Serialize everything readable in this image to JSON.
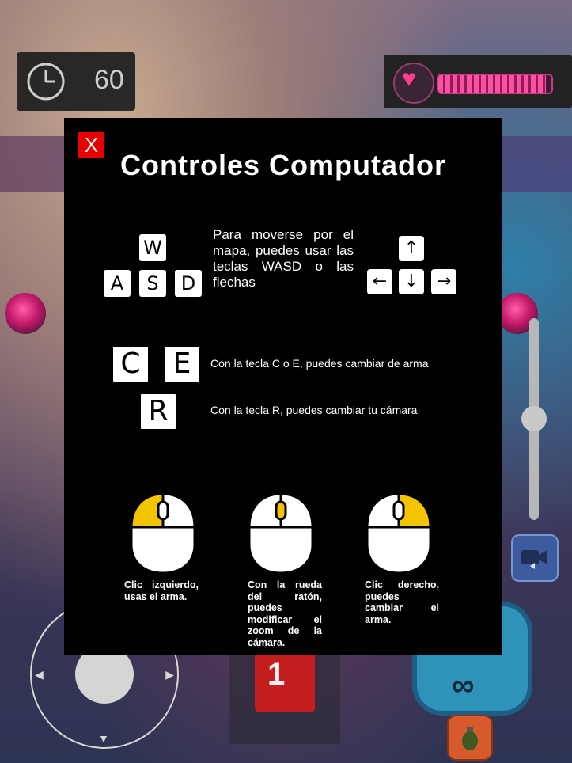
{
  "hud": {
    "timer_value": "60",
    "health_fraction": 0.95,
    "ammo_label": "∞",
    "weapon_label": "1"
  },
  "modal": {
    "close_label": "X",
    "title": "Controles Computador",
    "movement": {
      "keys": [
        "W",
        "A",
        "S",
        "D"
      ],
      "arrows": [
        "↑",
        "←",
        "↓",
        "→"
      ],
      "text": "Para moverse por el mapa, puedes usar las teclas WASD o las flechas"
    },
    "weapon_switch": {
      "keys": [
        "C",
        "E"
      ],
      "text": "Con la tecla C o E, puedes cambiar de arma"
    },
    "camera_switch": {
      "key": "R",
      "text": "Con la tecla R, puedes cambiar tu cámara"
    },
    "mouse": [
      {
        "text": "Clic izquierdo, usas el arma."
      },
      {
        "text": "Con la rueda del ratón, puedes modificar el zoom de la cámara."
      },
      {
        "text": "Clic derecho, puedes cambiar el arma."
      }
    ]
  },
  "colors": {
    "modal_bg": "#000000",
    "close_bg": "#e60000",
    "mouse_highlight": "#f5c400",
    "health": "#ff4fa3"
  }
}
